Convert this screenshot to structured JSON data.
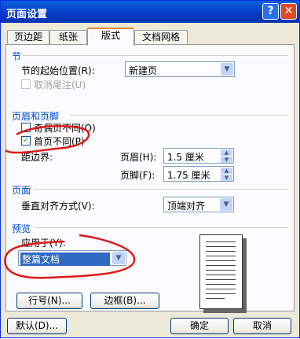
{
  "window": {
    "title": "页面设置",
    "help": "?",
    "close": "✕"
  },
  "tabs": [
    "页边距",
    "纸张",
    "版式",
    "文档网格"
  ],
  "section": {
    "title": "节",
    "start_label": "节的起始位置(R):",
    "start_value": "新建页",
    "suppress_endnotes": "取消尾注(U)"
  },
  "header_footer": {
    "title": "页眉和页脚",
    "odd_even": "奇偶页不同(O)",
    "first_page": "首页不同(P)",
    "from_edge": "距边界:",
    "header_label": "页眉(H):",
    "header_value": "1.5 厘米",
    "footer_label": "页脚(F):",
    "footer_value": "1.75 厘米"
  },
  "page": {
    "title": "页面",
    "valign_label": "垂直对齐方式(V):",
    "valign_value": "顶端对齐"
  },
  "preview": {
    "title": "预览",
    "apply_label": "应用于(Y):",
    "apply_value": "整篇文档"
  },
  "buttons": {
    "line_numbers": "行号(N)...",
    "borders": "边框(B)...",
    "default": "默认(D)...",
    "ok": "确定",
    "cancel": "取消"
  },
  "checks": {
    "first_page_checked": "✓"
  }
}
